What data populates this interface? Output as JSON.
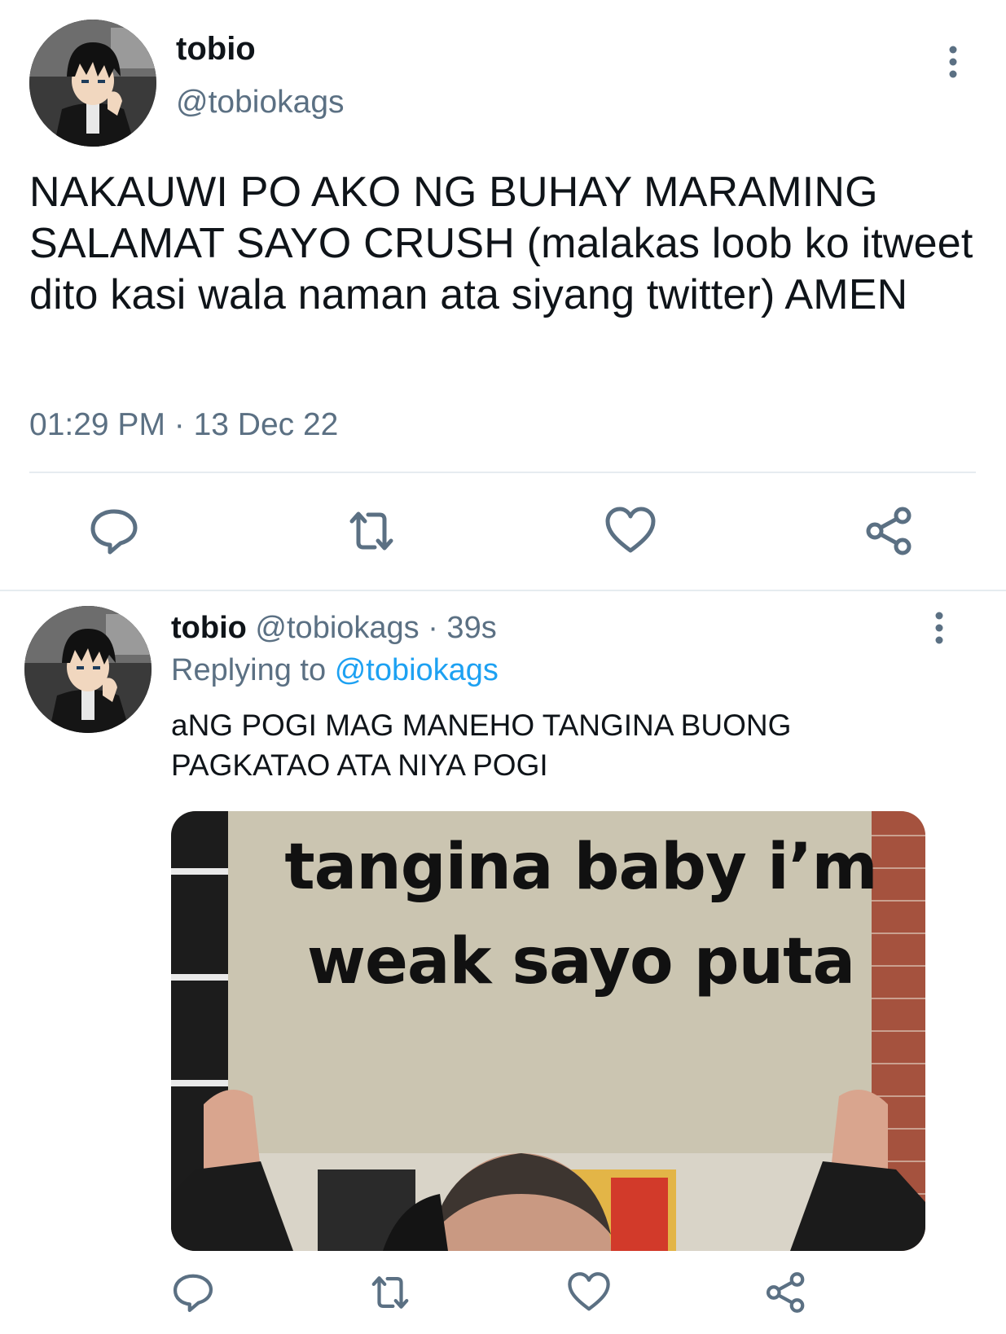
{
  "main_tweet": {
    "name": "tobio",
    "handle": "@tobiokags",
    "text": "NAKAUWI PO AKO NG BUHAY MARAMING SALAMAT SAYO CRUSH (malakas loob ko itweet dito kasi wala naman ata siyang twitter) AMEN",
    "timestamp": "01:29 PM · 13 Dec 22",
    "actions": [
      "reply-icon",
      "retweet-icon",
      "like-icon",
      "share-icon"
    ]
  },
  "reply_tweet": {
    "name": "tobio",
    "meta": "@tobiokags · 39s",
    "replying_prefix": "Replying to",
    "replying_handle": "@tobiokags",
    "text": "aNG POGI MAG MANEHO TANGINA BUONG PAGKATAO ATA NIYA POGI",
    "media": {
      "sign_line1": "tangina baby i’m",
      "sign_line2": "weak sayo puta"
    },
    "actions": [
      "reply-icon",
      "retweet-icon",
      "like-icon",
      "share-icon"
    ]
  },
  "colors": {
    "text_primary": "#0f1419",
    "text_secondary": "#5b7083",
    "link": "#1da1f2",
    "divider": "#e6ecf0",
    "icon": "#5b7083"
  }
}
